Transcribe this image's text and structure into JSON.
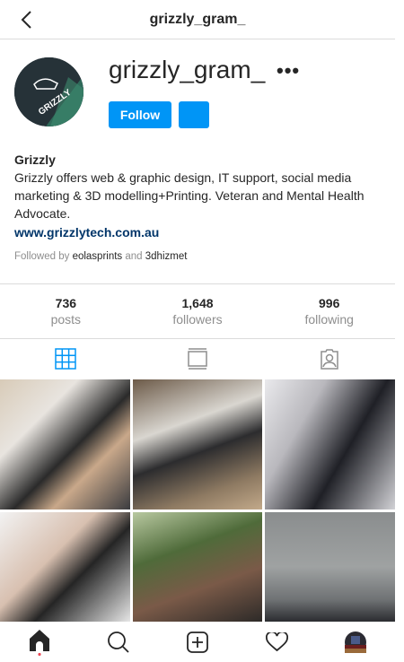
{
  "header": {
    "title": "grizzly_gram_"
  },
  "profile": {
    "username": "grizzly_gram_",
    "more": "•••",
    "follow_label": "Follow",
    "name": "Grizzly",
    "avatar_text": "GRIZZLY",
    "bio": "Grizzly offers web & graphic design, IT support, social media marketing & 3D modelling+Printing. Veteran and Mental Health Advocate.",
    "website": "www.grizzlytech.com.au",
    "followed_by_prefix": "Followed by ",
    "followed_by_1": "eolasprints",
    "followed_by_and": " and ",
    "followed_by_2": "3dhizmet"
  },
  "stats": [
    {
      "value": "736",
      "label": "posts"
    },
    {
      "value": "1,648",
      "label": "followers"
    },
    {
      "value": "996",
      "label": "following"
    }
  ],
  "colors": {
    "accent": "#0095f6",
    "link": "#003569",
    "notification": "#ed4956"
  }
}
